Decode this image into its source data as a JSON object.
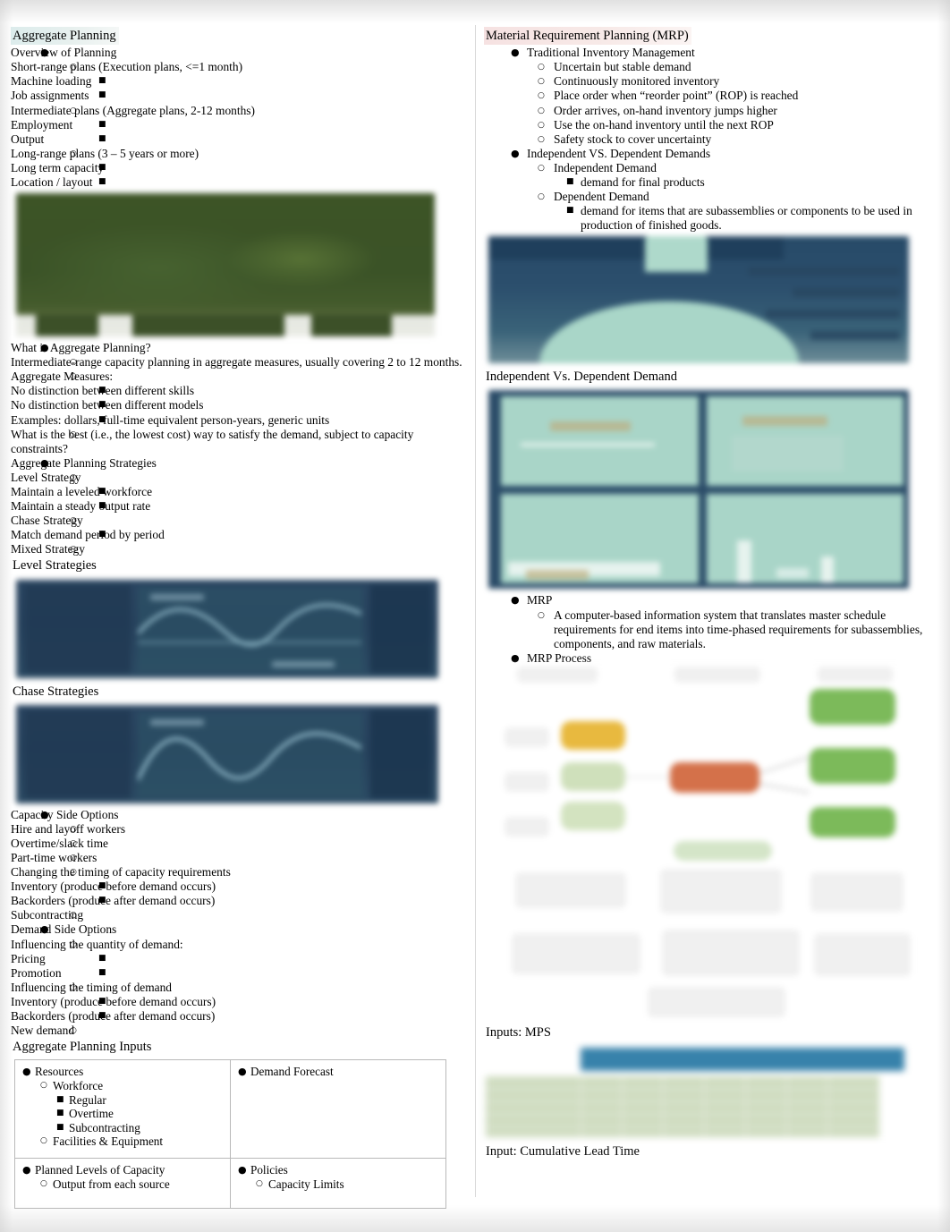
{
  "left_column": {
    "title": "Aggregate Planning",
    "outline_1": [
      {
        "level": 1,
        "text": "Overview of Planning"
      },
      {
        "level": 2,
        "text": "Short-range plans (Execution plans, <=1 month)"
      },
      {
        "level": 3,
        "text": "Machine loading"
      },
      {
        "level": 3,
        "text": "Job assignments"
      },
      {
        "level": 2,
        "text": "Intermediate plans (Aggregate plans, 2-12 months)"
      },
      {
        "level": 3,
        "text": "Employment"
      },
      {
        "level": 3,
        "text": "Output"
      },
      {
        "level": 2,
        "text": "Long-range plans (3 – 5 years or more)"
      },
      {
        "level": 3,
        "text": "Long term capacity"
      },
      {
        "level": 3,
        "text": "Location / layout"
      }
    ],
    "figure_1_name": "aggregate-planning-photo",
    "outline_2": [
      {
        "level": 1,
        "text": "What is Aggregate Planning?"
      },
      {
        "level": 2,
        "text": "Intermediate-range capacity planning in aggregate measures, usually covering 2 to 12 months."
      },
      {
        "level": 2,
        "text": "Aggregate Measures:"
      },
      {
        "level": 3,
        "text": "No distinction between different skills"
      },
      {
        "level": 3,
        "text": "No distinction between different models"
      },
      {
        "level": 3,
        "text": "Examples: dollars, full-time equivalent person-years, generic units"
      },
      {
        "level": 2,
        "text": "What is the best (i.e., the lowest cost) way to satisfy the demand, subject to capacity constraints?"
      },
      {
        "level": 1,
        "text": "Aggregate Planning Strategies"
      },
      {
        "level": 2,
        "text": "Level Strategy"
      },
      {
        "level": 3,
        "text": "Maintain a leveled workforce"
      },
      {
        "level": 3,
        "text": "Maintain a steady output rate"
      },
      {
        "level": 2,
        "text": "Chase Strategy"
      },
      {
        "level": 3,
        "text": "Match demand period by period"
      },
      {
        "level": 2,
        "text": "Mixed Strategy"
      }
    ],
    "caption_level": "Level Strategies",
    "caption_chase": "Chase Strategies",
    "outline_3": [
      {
        "level": 1,
        "text": "Capacity Side Options"
      },
      {
        "level": 2,
        "text": "Hire and layoff workers"
      },
      {
        "level": 2,
        "text": "Overtime/slack time"
      },
      {
        "level": 2,
        "text": "Part-time workers"
      },
      {
        "level": 2,
        "text": "Changing the timing of capacity requirements"
      },
      {
        "level": 3,
        "text": "Inventory (produce before demand occurs)"
      },
      {
        "level": 3,
        "text": "Backorders (produce after demand occurs)"
      },
      {
        "level": 2,
        "text": "Subcontracting"
      },
      {
        "level": 1,
        "text": "Demand Side Options"
      },
      {
        "level": 2,
        "text": "Influencing the quantity of demand:"
      },
      {
        "level": 3,
        "text": "Pricing"
      },
      {
        "level": 3,
        "text": "Promotion"
      },
      {
        "level": 2,
        "text": "Influencing the timing of demand"
      },
      {
        "level": 3,
        "text": "Inventory (produce before demand occurs)"
      },
      {
        "level": 3,
        "text": "Backorders (produce after demand occurs)"
      },
      {
        "level": 2,
        "text": "New demand"
      }
    ],
    "caption_inputs": "Aggregate Planning Inputs",
    "inputs_table": {
      "cell_top_left": [
        {
          "level": 1,
          "text": "Resources"
        },
        {
          "level": 2,
          "text": "Workforce"
        },
        {
          "level": 3,
          "text": "Regular"
        },
        {
          "level": 3,
          "text": "Overtime"
        },
        {
          "level": 3,
          "text": "Subcontracting"
        },
        {
          "level": 2,
          "text": "Facilities & Equipment"
        }
      ],
      "cell_top_right": [
        {
          "level": 1,
          "text": "Demand Forecast"
        }
      ],
      "cell_bottom_left": [
        {
          "level": 1,
          "text": "Planned Levels of Capacity"
        },
        {
          "level": 2,
          "text": "Output from each source"
        }
      ],
      "cell_bottom_right": [
        {
          "level": 1,
          "text": "Policies"
        },
        {
          "level": 2,
          "text": "Capacity Limits"
        }
      ]
    }
  },
  "right_column": {
    "title": "Material Requirement Planning (MRP)",
    "outline_1": [
      {
        "level": 1,
        "text": "Traditional Inventory Management"
      },
      {
        "level": 2,
        "text": "Uncertain but stable demand"
      },
      {
        "level": 2,
        "text": "Continuously monitored inventory"
      },
      {
        "level": 2,
        "text": "Place order when “reorder point” (ROP) is reached"
      },
      {
        "level": 2,
        "text": "Order arrives, on-hand inventory jumps higher"
      },
      {
        "level": 2,
        "text": "Use the on-hand inventory until the next ROP"
      },
      {
        "level": 2,
        "text": "Safety stock to cover uncertainty"
      },
      {
        "level": 1,
        "text": "Independent VS. Dependent Demands"
      },
      {
        "level": 2,
        "text": "Independent Demand"
      },
      {
        "level": 3,
        "text": "demand for final products"
      },
      {
        "level": 2,
        "text": "Dependent Demand"
      },
      {
        "level": 3,
        "text": "demand for items that are subassemblies or components to be used in production of finished goods."
      }
    ],
    "caption_indep_dep": "Independent Vs. Dependent Demand",
    "outline_2": [
      {
        "level": 1,
        "text": "MRP"
      },
      {
        "level": 2,
        "text": "A computer-based information system that translates master schedule requirements for end items into time-phased requirements for subassemblies, components, and raw materials."
      },
      {
        "level": 1,
        "text": "MRP Process"
      }
    ],
    "caption_mps": "Inputs: MPS",
    "caption_clt": "Input: Cumulative Lead Time"
  },
  "bullets": {
    "level1": "●",
    "level2": "○",
    "level3": "■"
  },
  "colors": {
    "heading_highlight_left": "#dcecec",
    "heading_highlight_right": "#f6e2e2",
    "chart_slide_bg": "#26415c",
    "teal_photo": "#a9d6c8",
    "green_photo": "#3d5426",
    "mps_header": "#3782ab",
    "mps_body": "#cfdcc0",
    "flow_node_yellow": "#e8b93f",
    "flow_node_orange": "#d4714a",
    "flow_node_green": "#7cba5a"
  }
}
